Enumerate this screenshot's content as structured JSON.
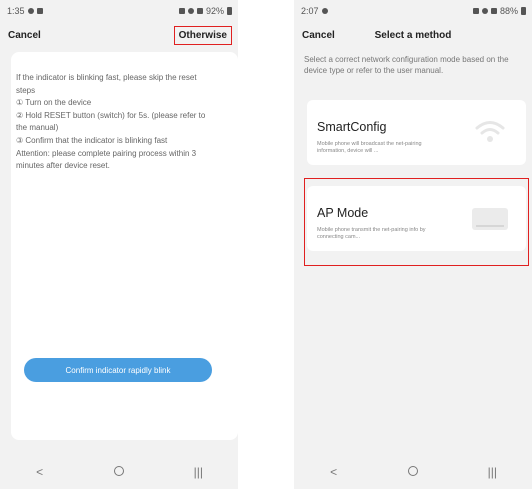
{
  "left_screen": {
    "status": {
      "time": "1:35",
      "battery": "92%"
    },
    "header": {
      "cancel": "Cancel",
      "otherwise": "Otherwise"
    },
    "instructions": {
      "intro": "If the indicator is blinking fast, please skip the reset steps",
      "step1": "① Turn on the device",
      "step2": "② Hold RESET button (switch) for 5s. (please refer to the manual)",
      "step3": "③ Confirm that the indicator is blinking fast",
      "attention": "Attention: please complete pairing process within 3 minutes after device reset."
    },
    "confirm_button": "Confirm indicator rapidly blink",
    "nav": {
      "back": "<",
      "home": "○",
      "recents": "|||"
    }
  },
  "right_screen": {
    "status": {
      "time": "2:07",
      "battery": "88%"
    },
    "header": {
      "cancel": "Cancel",
      "title": "Select a method"
    },
    "hint": "Select a correct network configuration mode based on the device type or refer to the user manual.",
    "methods": [
      {
        "title": "SmartConfig",
        "desc": "Mobile phone will broadcast the net-pairing information, device will ..."
      },
      {
        "title": "AP Mode",
        "desc": "Mobile phone transmit the net-pairing info by connecting cam..."
      }
    ],
    "nav": {
      "back": "<",
      "home": "○",
      "recents": "|||"
    }
  },
  "colors": {
    "accent": "#4a9ee0",
    "highlight_outline": "#e02020",
    "background": "#f2f2f2"
  }
}
